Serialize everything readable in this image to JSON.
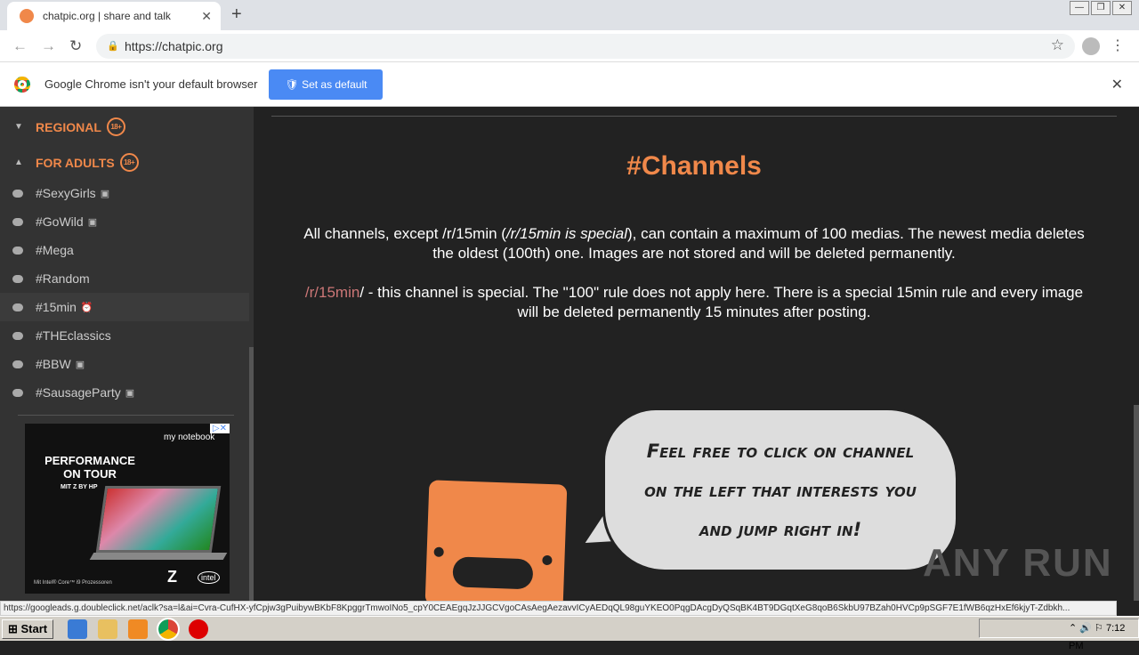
{
  "browser": {
    "tab_title": "chatpic.org | share and talk",
    "url": "https://chatpic.org",
    "infobar_text": "Google Chrome isn't your default browser",
    "set_default_label": "Set as default",
    "status_url": "https://googleads.g.doubleclick.net/aclk?sa=l&ai=Cvra-CufHX-yfCpjw3gPuibywBKbF8KpggrTmwoINo5_cpY0CEAEgqJzJJGCVgoCAsAegAezavvICyAEDqQL98guYKEO0PqgDAcgDyQSqBK4BT9DGqtXeG8qoB6SkbU97BZah0HVCp9pSGF7E1fWB6qzHxEf6kjyT-Zdbkh..."
  },
  "sidebar": {
    "sections": [
      {
        "label": "REGIONAL",
        "badge": "18+",
        "expanded": false
      },
      {
        "label": "FOR ADULTS",
        "badge": "18+",
        "expanded": true
      }
    ],
    "items": [
      {
        "label": "#SexyGirls",
        "icon": "images-icon"
      },
      {
        "label": "#GoWild",
        "icon": "images-icon"
      },
      {
        "label": "#Mega",
        "icon": ""
      },
      {
        "label": "#Random",
        "icon": ""
      },
      {
        "label": "#15min",
        "icon": "alarm-clock-icon",
        "active": true
      },
      {
        "label": "#THEclassics",
        "icon": ""
      },
      {
        "label": "#BBW",
        "icon": "images-icon"
      },
      {
        "label": "#SausageParty",
        "icon": "images-icon"
      }
    ],
    "ad": {
      "headline": "PERFORMANCE ON TOUR",
      "sub": "MIT Z BY HP",
      "brand": "my notebook",
      "footer": "Mit Intel® Core™ i9 Prozessoren",
      "z": "Z",
      "intel": "intel"
    }
  },
  "main": {
    "title": "#Channels",
    "p1_a": "All channels, except /r/15min (",
    "p1_i": "/r/15min is special",
    "p1_b": "), can contain a maximum of 100 medias. The newest media deletes the oldest (100th) one. Images are not stored and will be deleted permanently.",
    "p2_link": "/r/15min",
    "p2_text": "/ - this channel is special. The \"100\" rule does not apply here. There is a special 15min rule and every image will be deleted permanently 15 minutes after posting.",
    "speech": [
      "Feel free to click on channel",
      "on the left that interests you",
      "and jump right in!"
    ],
    "watermark": "ANY RUN"
  },
  "taskbar": {
    "start": "Start",
    "clock": "7:12 PM"
  },
  "colors": {
    "accent": "#f0884a",
    "sidebar": "#333333",
    "main": "#222222"
  }
}
